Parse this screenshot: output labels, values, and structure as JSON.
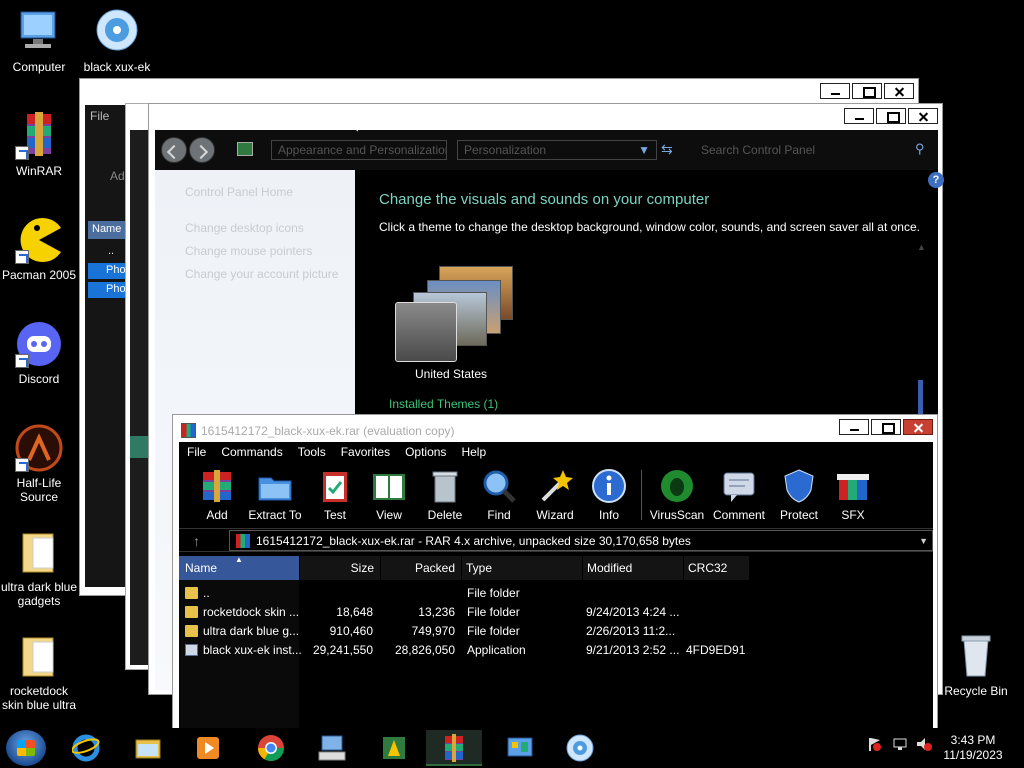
{
  "desktop": {
    "icons": [
      {
        "label": "Computer"
      },
      {
        "label": "black xux-ek"
      },
      {
        "label": "WinRAR"
      },
      {
        "label": "Pacman 2005"
      },
      {
        "label": "Discord"
      },
      {
        "label": "Half-Life Source"
      },
      {
        "label": "ultra dark blue gadgets"
      },
      {
        "label": "rocketdock skin blue ultra"
      },
      {
        "label": "Recycle Bin"
      }
    ]
  },
  "back_window": {
    "menu_label": "File",
    "toolbar_label": "Add",
    "name_header": "Name",
    "rows": [
      "..",
      "Pho",
      "Pho"
    ]
  },
  "control_panel": {
    "breadcrumb_1": "Appearance and Personalization",
    "breadcrumb_2": "Personalization",
    "search_placeholder": "Search Control Panel",
    "left_links": [
      "Control Panel Home",
      "Change desktop icons",
      "Change mouse pointers",
      "Change your account picture"
    ],
    "heading": "Change the visuals and sounds on your computer",
    "description": "Click a theme to change the desktop background, window color, sounds, and screen saver all at once.",
    "theme_name": "United States",
    "installed_label": "Installed Themes (1)",
    "help": "?"
  },
  "winrar": {
    "title": "1615412172_black-xux-ek.rar (evaluation copy)",
    "menu": [
      "File",
      "Commands",
      "Tools",
      "Favorites",
      "Options",
      "Help"
    ],
    "toolbar": [
      "Add",
      "Extract To",
      "Test",
      "View",
      "Delete",
      "Find",
      "Wizard",
      "Info",
      "VirusScan",
      "Comment",
      "Protect",
      "SFX"
    ],
    "path": "1615412172_black-xux-ek.rar - RAR 4.x archive, unpacked size 30,170,658 bytes",
    "columns": [
      "Name",
      "Size",
      "Packed",
      "Type",
      "Modified",
      "CRC32"
    ],
    "rows": [
      {
        "name": "..",
        "size": "",
        "packed": "",
        "type": "File folder",
        "modified": "",
        "crc": ""
      },
      {
        "name": "rocketdock skin ...",
        "size": "18,648",
        "packed": "13,236",
        "type": "File folder",
        "modified": "9/24/2013 4:24 ...",
        "crc": ""
      },
      {
        "name": "ultra dark blue g...",
        "size": "910,460",
        "packed": "749,970",
        "type": "File folder",
        "modified": "2/26/2013 11:2...",
        "crc": ""
      },
      {
        "name": "black xux-ek inst...",
        "size": "29,241,550",
        "packed": "28,826,050",
        "type": "Application",
        "modified": "9/21/2013 2:52 ...",
        "crc": "4FD9ED91"
      }
    ]
  },
  "taskbar": {
    "time": "3:43 PM",
    "date": "11/19/2023"
  },
  "colors": {
    "accent_heading": "#7cd3c2",
    "installed_green": "#3fc279",
    "selection_blue": "#36589a",
    "close_red": "#c84031"
  }
}
